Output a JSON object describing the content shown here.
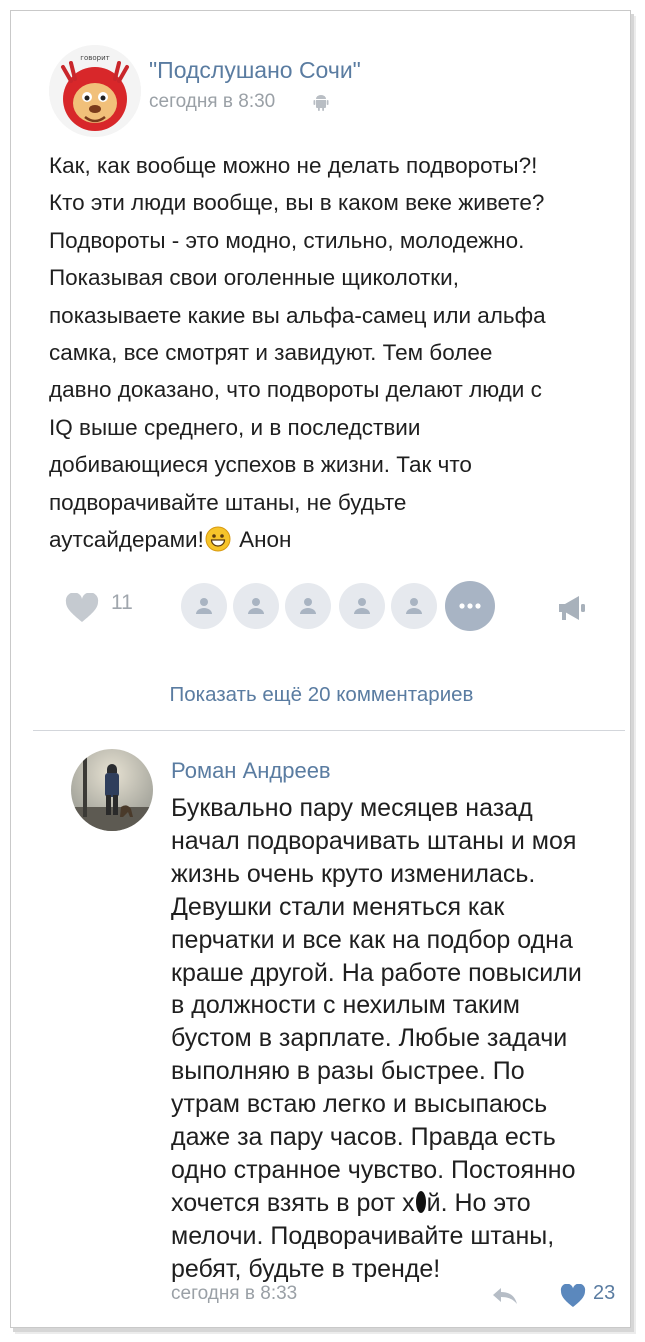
{
  "post": {
    "author": "\"Подслушано Сочи\"",
    "time": "сегодня в 8:30",
    "avatar_icon": "deer-mascot-avatar",
    "lines": [
      "Как, как вообще можно не делать подвороты?!",
      "Кто эти люди вообще, вы в каком веке живете?",
      "Подвороты - это модно, стильно, молодежно.",
      "Показывая свои оголенные щиколотки,",
      "показываете какие вы альфа-самец или альфа",
      "самка, все смотрят и завидуют. Тем более",
      "давно доказано, что подвороты делают люди с",
      "IQ выше среднего, и в последствии",
      "добивающиеся успехов в жизни. Так что",
      "подворачивайте штаны, не будьте"
    ],
    "last_line_before_emoji": "аутсайдерами!",
    "last_line_after_emoji": " Анон",
    "emoji_icon": "grinning-face-emoji",
    "likes": "11",
    "likers_count_shown": 5,
    "more_likers_icon": "ellipsis-icon",
    "share_icon": "megaphone-icon"
  },
  "show_more": "Показать ещё 20 комментариев",
  "comment": {
    "author": "Роман Андреев",
    "lines": [
      "Буквально пару месяцев назад",
      "начал подворачивать штаны и моя",
      "жизнь очень круто изменилась.",
      "Девушки стали меняться как",
      "перчатки и все как на подбор одна",
      "краше другой. На работе повысили",
      "в должности с нехилым таким",
      "бустом в зарплате. Любые задачи",
      "выполняю в разы быстрее. По",
      "утрам встаю легко и высыпаюсь",
      "даже за пару часов. Правда есть",
      "одно странное чувство. Постоянно",
      "хочется взять в рот х",
      "мелочи. Подворачивайте штаны,",
      "ребят, будьте в тренде!"
    ],
    "censored_line_tail": "й. Но это",
    "time": "сегодня в 8:33",
    "likes": "23"
  },
  "colors": {
    "link": "#5a7ca1",
    "text": "#1f1f1f",
    "muted": "#9aa0a6",
    "like_gray": "#c5cad0",
    "like_blue": "#5b88bd"
  }
}
